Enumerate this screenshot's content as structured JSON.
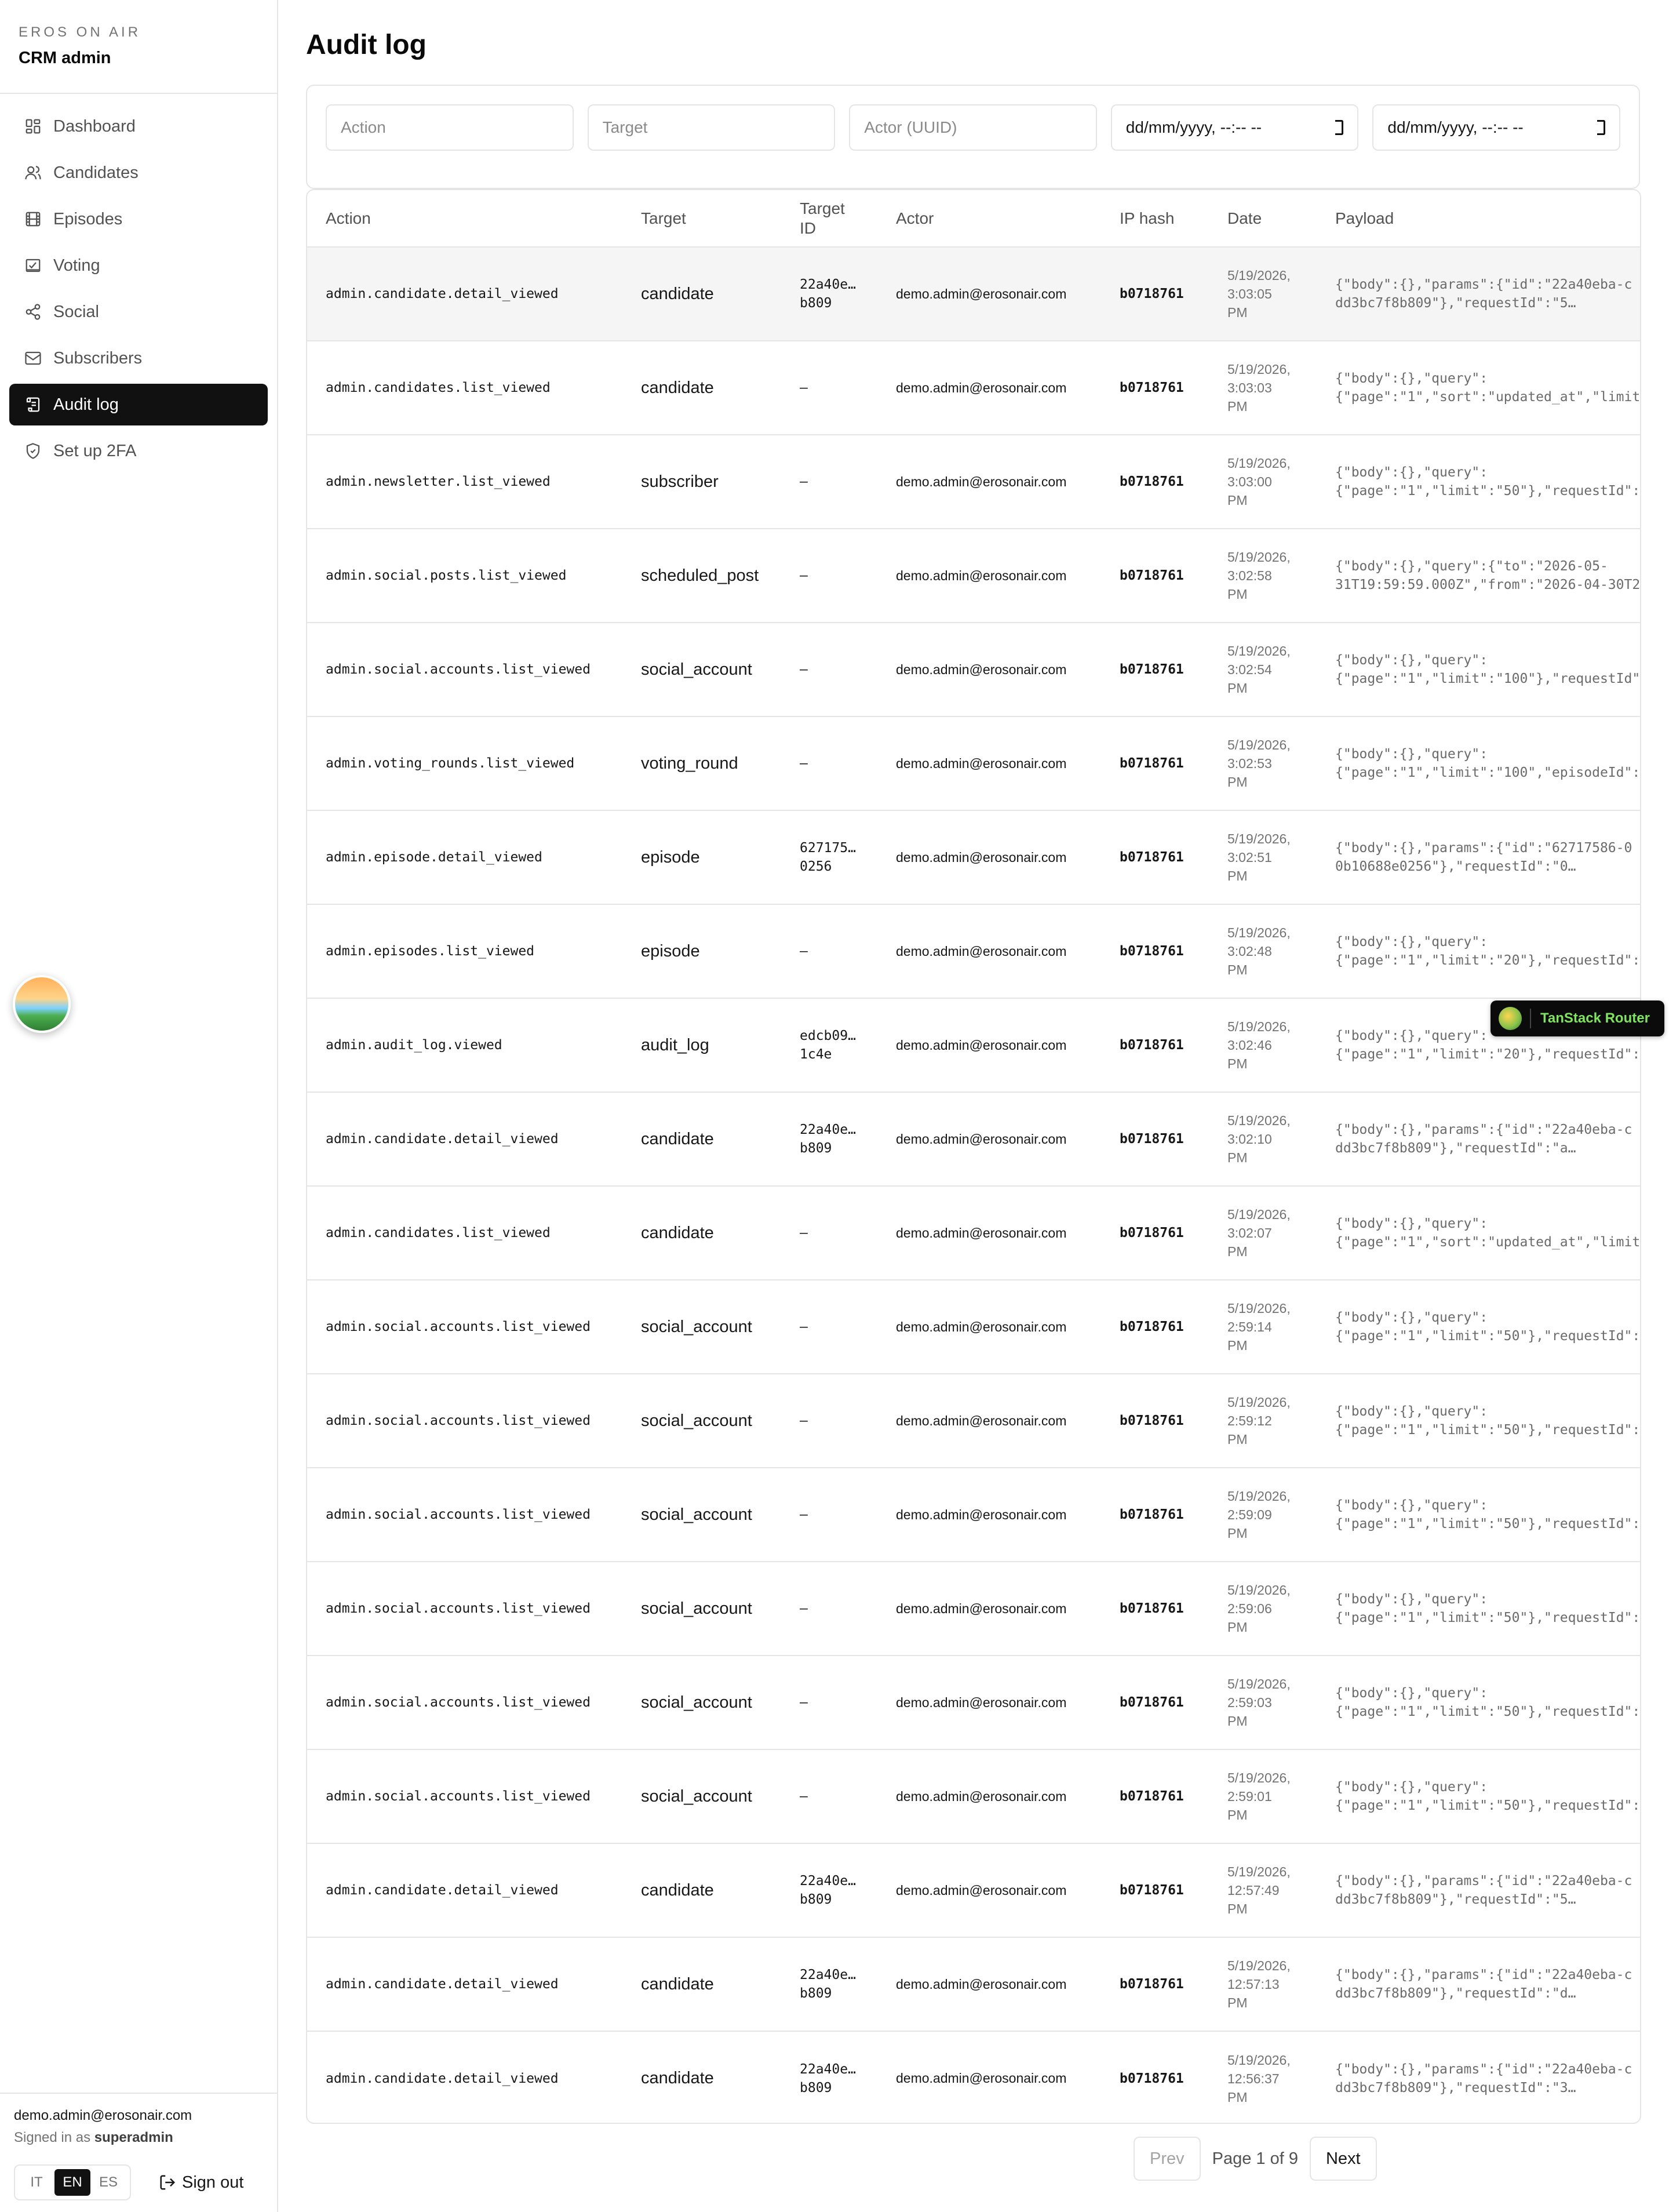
{
  "brand": {
    "eyebrow": "EROS ON AIR",
    "title": "CRM admin"
  },
  "nav": [
    {
      "label": "Dashboard",
      "icon": "grid-icon"
    },
    {
      "label": "Candidates",
      "icon": "users-icon"
    },
    {
      "label": "Episodes",
      "icon": "film-icon"
    },
    {
      "label": "Voting",
      "icon": "vote-icon"
    },
    {
      "label": "Social",
      "icon": "share-icon"
    },
    {
      "label": "Subscribers",
      "icon": "mail-icon"
    },
    {
      "label": "Audit log",
      "icon": "scroll-icon",
      "active": true
    },
    {
      "label": "Set up 2FA",
      "icon": "shield-icon"
    }
  ],
  "footer": {
    "email": "demo.admin@erosonair.com",
    "signed_in_prefix": "Signed in as",
    "role": "superadmin",
    "languages": [
      "IT",
      "EN",
      "ES"
    ],
    "active_language": "EN",
    "sign_out": "Sign out"
  },
  "page": {
    "title": "Audit log"
  },
  "filters": {
    "action_placeholder": "Action",
    "target_placeholder": "Target",
    "actor_placeholder": "Actor (UUID)",
    "date_from": "dd/mm/yyyy, --:-- --",
    "date_to": "dd/mm/yyyy, --:-- --"
  },
  "table": {
    "headers": {
      "action": "Action",
      "target": "Target",
      "target_id_1": "Target",
      "target_id_2": "ID",
      "actor": "Actor",
      "ip": "IP hash",
      "date": "Date",
      "payload": "Payload"
    },
    "rows": [
      {
        "action": "admin.candidate.detail_viewed",
        "target": "candidate",
        "tid1": "22a40e…",
        "tid2": "b809",
        "actor": "demo.admin@erosonair.com",
        "ip": "b0718761",
        "d1": "5/19/2026,",
        "d2": "3:03:05",
        "d3": "PM",
        "p1": "{\"body\":{},\"params\":{\"id\":\"22a40eba-c",
        "p2": "dd3bc7f8b809\"},\"requestId\":\"5…"
      },
      {
        "action": "admin.candidates.list_viewed",
        "target": "candidate",
        "tid1": "–",
        "tid2": "",
        "actor": "demo.admin@erosonair.com",
        "ip": "b0718761",
        "d1": "5/19/2026,",
        "d2": "3:03:03",
        "d3": "PM",
        "p1": "{\"body\":{},\"query\":",
        "p2": "{\"page\":\"1\",\"sort\":\"updated_at\",\"limit"
      },
      {
        "action": "admin.newsletter.list_viewed",
        "target": "subscriber",
        "tid1": "–",
        "tid2": "",
        "actor": "demo.admin@erosonair.com",
        "ip": "b0718761",
        "d1": "5/19/2026,",
        "d2": "3:03:00",
        "d3": "PM",
        "p1": "{\"body\":{},\"query\":",
        "p2": "{\"page\":\"1\",\"limit\":\"50\"},\"requestId\":"
      },
      {
        "action": "admin.social.posts.list_viewed",
        "target": "scheduled_post",
        "tid1": "–",
        "tid2": "",
        "actor": "demo.admin@erosonair.com",
        "ip": "b0718761",
        "d1": "5/19/2026,",
        "d2": "3:02:58",
        "d3": "PM",
        "p1": "{\"body\":{},\"query\":{\"to\":\"2026-05-",
        "p2": "31T19:59:59.000Z\",\"from\":\"2026-04-30T2"
      },
      {
        "action": "admin.social.accounts.list_viewed",
        "target": "social_account",
        "tid1": "–",
        "tid2": "",
        "actor": "demo.admin@erosonair.com",
        "ip": "b0718761",
        "d1": "5/19/2026,",
        "d2": "3:02:54",
        "d3": "PM",
        "p1": "{\"body\":{},\"query\":",
        "p2": "{\"page\":\"1\",\"limit\":\"100\"},\"requestId\""
      },
      {
        "action": "admin.voting_rounds.list_viewed",
        "target": "voting_round",
        "tid1": "–",
        "tid2": "",
        "actor": "demo.admin@erosonair.com",
        "ip": "b0718761",
        "d1": "5/19/2026,",
        "d2": "3:02:53",
        "d3": "PM",
        "p1": "{\"body\":{},\"query\":",
        "p2": "{\"page\":\"1\",\"limit\":\"100\",\"episodeId\":"
      },
      {
        "action": "admin.episode.detail_viewed",
        "target": "episode",
        "tid1": "627175…",
        "tid2": "0256",
        "actor": "demo.admin@erosonair.com",
        "ip": "b0718761",
        "d1": "5/19/2026,",
        "d2": "3:02:51",
        "d3": "PM",
        "p1": "{\"body\":{},\"params\":{\"id\":\"62717586-0",
        "p2": "0b10688e0256\"},\"requestId\":\"0…"
      },
      {
        "action": "admin.episodes.list_viewed",
        "target": "episode",
        "tid1": "–",
        "tid2": "",
        "actor": "demo.admin@erosonair.com",
        "ip": "b0718761",
        "d1": "5/19/2026,",
        "d2": "3:02:48",
        "d3": "PM",
        "p1": "{\"body\":{},\"query\":",
        "p2": "{\"page\":\"1\",\"limit\":\"20\"},\"requestId\":"
      },
      {
        "action": "admin.audit_log.viewed",
        "target": "audit_log",
        "tid1": "edcb09…",
        "tid2": "1c4e",
        "actor": "demo.admin@erosonair.com",
        "ip": "b0718761",
        "d1": "5/19/2026,",
        "d2": "3:02:46",
        "d3": "PM",
        "p1": "{\"body\":{},\"query\":",
        "p2": "{\"page\":\"1\",\"limit\":\"20\"},\"requestId\":"
      },
      {
        "action": "admin.candidate.detail_viewed",
        "target": "candidate",
        "tid1": "22a40e…",
        "tid2": "b809",
        "actor": "demo.admin@erosonair.com",
        "ip": "b0718761",
        "d1": "5/19/2026,",
        "d2": "3:02:10",
        "d3": "PM",
        "p1": "{\"body\":{},\"params\":{\"id\":\"22a40eba-c",
        "p2": "dd3bc7f8b809\"},\"requestId\":\"a…"
      },
      {
        "action": "admin.candidates.list_viewed",
        "target": "candidate",
        "tid1": "–",
        "tid2": "",
        "actor": "demo.admin@erosonair.com",
        "ip": "b0718761",
        "d1": "5/19/2026,",
        "d2": "3:02:07",
        "d3": "PM",
        "p1": "{\"body\":{},\"query\":",
        "p2": "{\"page\":\"1\",\"sort\":\"updated_at\",\"limit"
      },
      {
        "action": "admin.social.accounts.list_viewed",
        "target": "social_account",
        "tid1": "–",
        "tid2": "",
        "actor": "demo.admin@erosonair.com",
        "ip": "b0718761",
        "d1": "5/19/2026,",
        "d2": "2:59:14",
        "d3": "PM",
        "p1": "{\"body\":{},\"query\":",
        "p2": "{\"page\":\"1\",\"limit\":\"50\"},\"requestId\":"
      },
      {
        "action": "admin.social.accounts.list_viewed",
        "target": "social_account",
        "tid1": "–",
        "tid2": "",
        "actor": "demo.admin@erosonair.com",
        "ip": "b0718761",
        "d1": "5/19/2026,",
        "d2": "2:59:12",
        "d3": "PM",
        "p1": "{\"body\":{},\"query\":",
        "p2": "{\"page\":\"1\",\"limit\":\"50\"},\"requestId\":"
      },
      {
        "action": "admin.social.accounts.list_viewed",
        "target": "social_account",
        "tid1": "–",
        "tid2": "",
        "actor": "demo.admin@erosonair.com",
        "ip": "b0718761",
        "d1": "5/19/2026,",
        "d2": "2:59:09",
        "d3": "PM",
        "p1": "{\"body\":{},\"query\":",
        "p2": "{\"page\":\"1\",\"limit\":\"50\"},\"requestId\":"
      },
      {
        "action": "admin.social.accounts.list_viewed",
        "target": "social_account",
        "tid1": "–",
        "tid2": "",
        "actor": "demo.admin@erosonair.com",
        "ip": "b0718761",
        "d1": "5/19/2026,",
        "d2": "2:59:06",
        "d3": "PM",
        "p1": "{\"body\":{},\"query\":",
        "p2": "{\"page\":\"1\",\"limit\":\"50\"},\"requestId\":"
      },
      {
        "action": "admin.social.accounts.list_viewed",
        "target": "social_account",
        "tid1": "–",
        "tid2": "",
        "actor": "demo.admin@erosonair.com",
        "ip": "b0718761",
        "d1": "5/19/2026,",
        "d2": "2:59:03",
        "d3": "PM",
        "p1": "{\"body\":{},\"query\":",
        "p2": "{\"page\":\"1\",\"limit\":\"50\"},\"requestId\":"
      },
      {
        "action": "admin.social.accounts.list_viewed",
        "target": "social_account",
        "tid1": "–",
        "tid2": "",
        "actor": "demo.admin@erosonair.com",
        "ip": "b0718761",
        "d1": "5/19/2026,",
        "d2": "2:59:01",
        "d3": "PM",
        "p1": "{\"body\":{},\"query\":",
        "p2": "{\"page\":\"1\",\"limit\":\"50\"},\"requestId\":"
      },
      {
        "action": "admin.candidate.detail_viewed",
        "target": "candidate",
        "tid1": "22a40e…",
        "tid2": "b809",
        "actor": "demo.admin@erosonair.com",
        "ip": "b0718761",
        "d1": "5/19/2026,",
        "d2": "12:57:49",
        "d3": "PM",
        "p1": "{\"body\":{},\"params\":{\"id\":\"22a40eba-c",
        "p2": "dd3bc7f8b809\"},\"requestId\":\"5…"
      },
      {
        "action": "admin.candidate.detail_viewed",
        "target": "candidate",
        "tid1": "22a40e…",
        "tid2": "b809",
        "actor": "demo.admin@erosonair.com",
        "ip": "b0718761",
        "d1": "5/19/2026,",
        "d2": "12:57:13",
        "d3": "PM",
        "p1": "{\"body\":{},\"params\":{\"id\":\"22a40eba-c",
        "p2": "dd3bc7f8b809\"},\"requestId\":\"d…"
      },
      {
        "action": "admin.candidate.detail_viewed",
        "target": "candidate",
        "tid1": "22a40e…",
        "tid2": "b809",
        "actor": "demo.admin@erosonair.com",
        "ip": "b0718761",
        "d1": "5/19/2026,",
        "d2": "12:56:37",
        "d3": "PM",
        "p1": "{\"body\":{},\"params\":{\"id\":\"22a40eba-c",
        "p2": "dd3bc7f8b809\"},\"requestId\":\"3…"
      }
    ]
  },
  "pagination": {
    "prev": "Prev",
    "info": "Page 1 of 9",
    "next": "Next"
  },
  "devtools": {
    "label": "TanStack Router"
  },
  "colors": {
    "accent": "#111111",
    "border": "#e5e5e5",
    "muted": "#737373",
    "devtools_text": "#7ee35f"
  }
}
